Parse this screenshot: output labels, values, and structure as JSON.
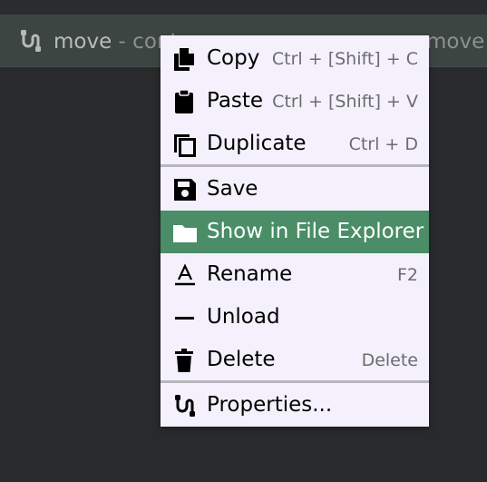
{
  "item_bar": {
    "name": "move",
    "suffix": " - cont",
    "right_text": "move"
  },
  "context_menu": {
    "items": [
      {
        "label": "Copy",
        "shortcut": "Ctrl + [Shift] + C",
        "icon": "copy-icon"
      },
      {
        "label": "Paste",
        "shortcut": "Ctrl + [Shift] + V",
        "icon": "clipboard-icon"
      },
      {
        "label": "Duplicate",
        "shortcut": "Ctrl + D",
        "icon": "duplicate-icon"
      },
      {
        "label": "Save",
        "shortcut": "",
        "icon": "save-icon"
      },
      {
        "label": "Show in File Explorer",
        "shortcut": "",
        "icon": "folder-icon",
        "highlighted": true
      },
      {
        "label": "Rename",
        "shortcut": "F2",
        "icon": "rename-icon"
      },
      {
        "label": "Unload",
        "shortcut": "",
        "icon": "unload-icon"
      },
      {
        "label": "Delete",
        "shortcut": "Delete",
        "icon": "trash-icon"
      },
      {
        "label": "Properties...",
        "shortcut": "",
        "icon": "properties-icon"
      }
    ]
  },
  "colors": {
    "background": "#282a2c",
    "item_bar": "#3d4542",
    "menu_background": "#f4f1fd",
    "highlight": "#4a8d67",
    "separator": "#b7b6bd"
  }
}
